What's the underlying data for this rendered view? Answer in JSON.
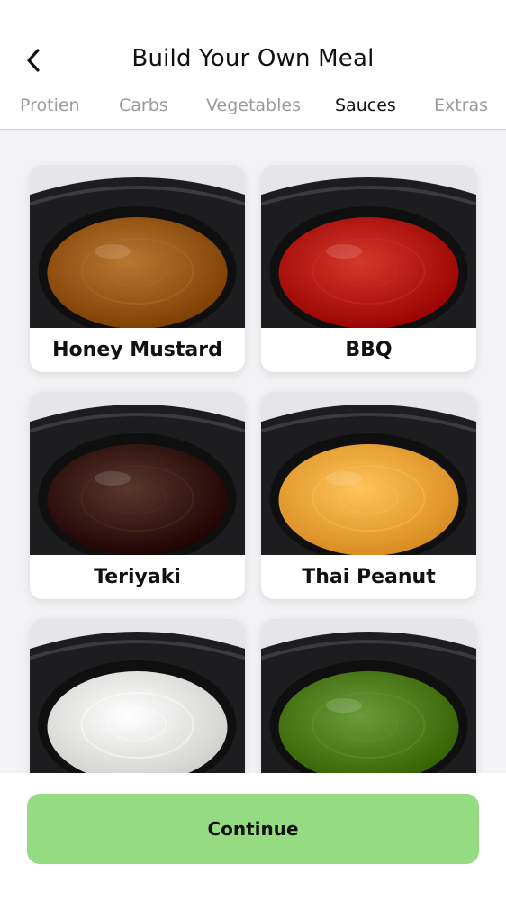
{
  "header": {
    "title": "Build Your Own Meal",
    "back_icon": "chevron-left-icon"
  },
  "tabs": [
    {
      "label": "Protien",
      "active": false
    },
    {
      "label": "Carbs",
      "active": false
    },
    {
      "label": "Vegetables",
      "active": false
    },
    {
      "label": "Sauces",
      "active": true
    },
    {
      "label": "Extras",
      "active": false
    }
  ],
  "sauces": [
    {
      "name": "Honey Mustard",
      "color": "#9a5a14"
    },
    {
      "name": "BBQ",
      "color": "#b51a0c"
    },
    {
      "name": "Teriyaki",
      "color": "#3a1a0e"
    },
    {
      "name": "Thai Peanut",
      "color": "#f4a63c"
    },
    {
      "name": "",
      "color": "#ecebe8"
    },
    {
      "name": "",
      "color": "#4f7d1e"
    }
  ],
  "footer": {
    "continue_label": "Continue",
    "button_color": "#95db81"
  }
}
